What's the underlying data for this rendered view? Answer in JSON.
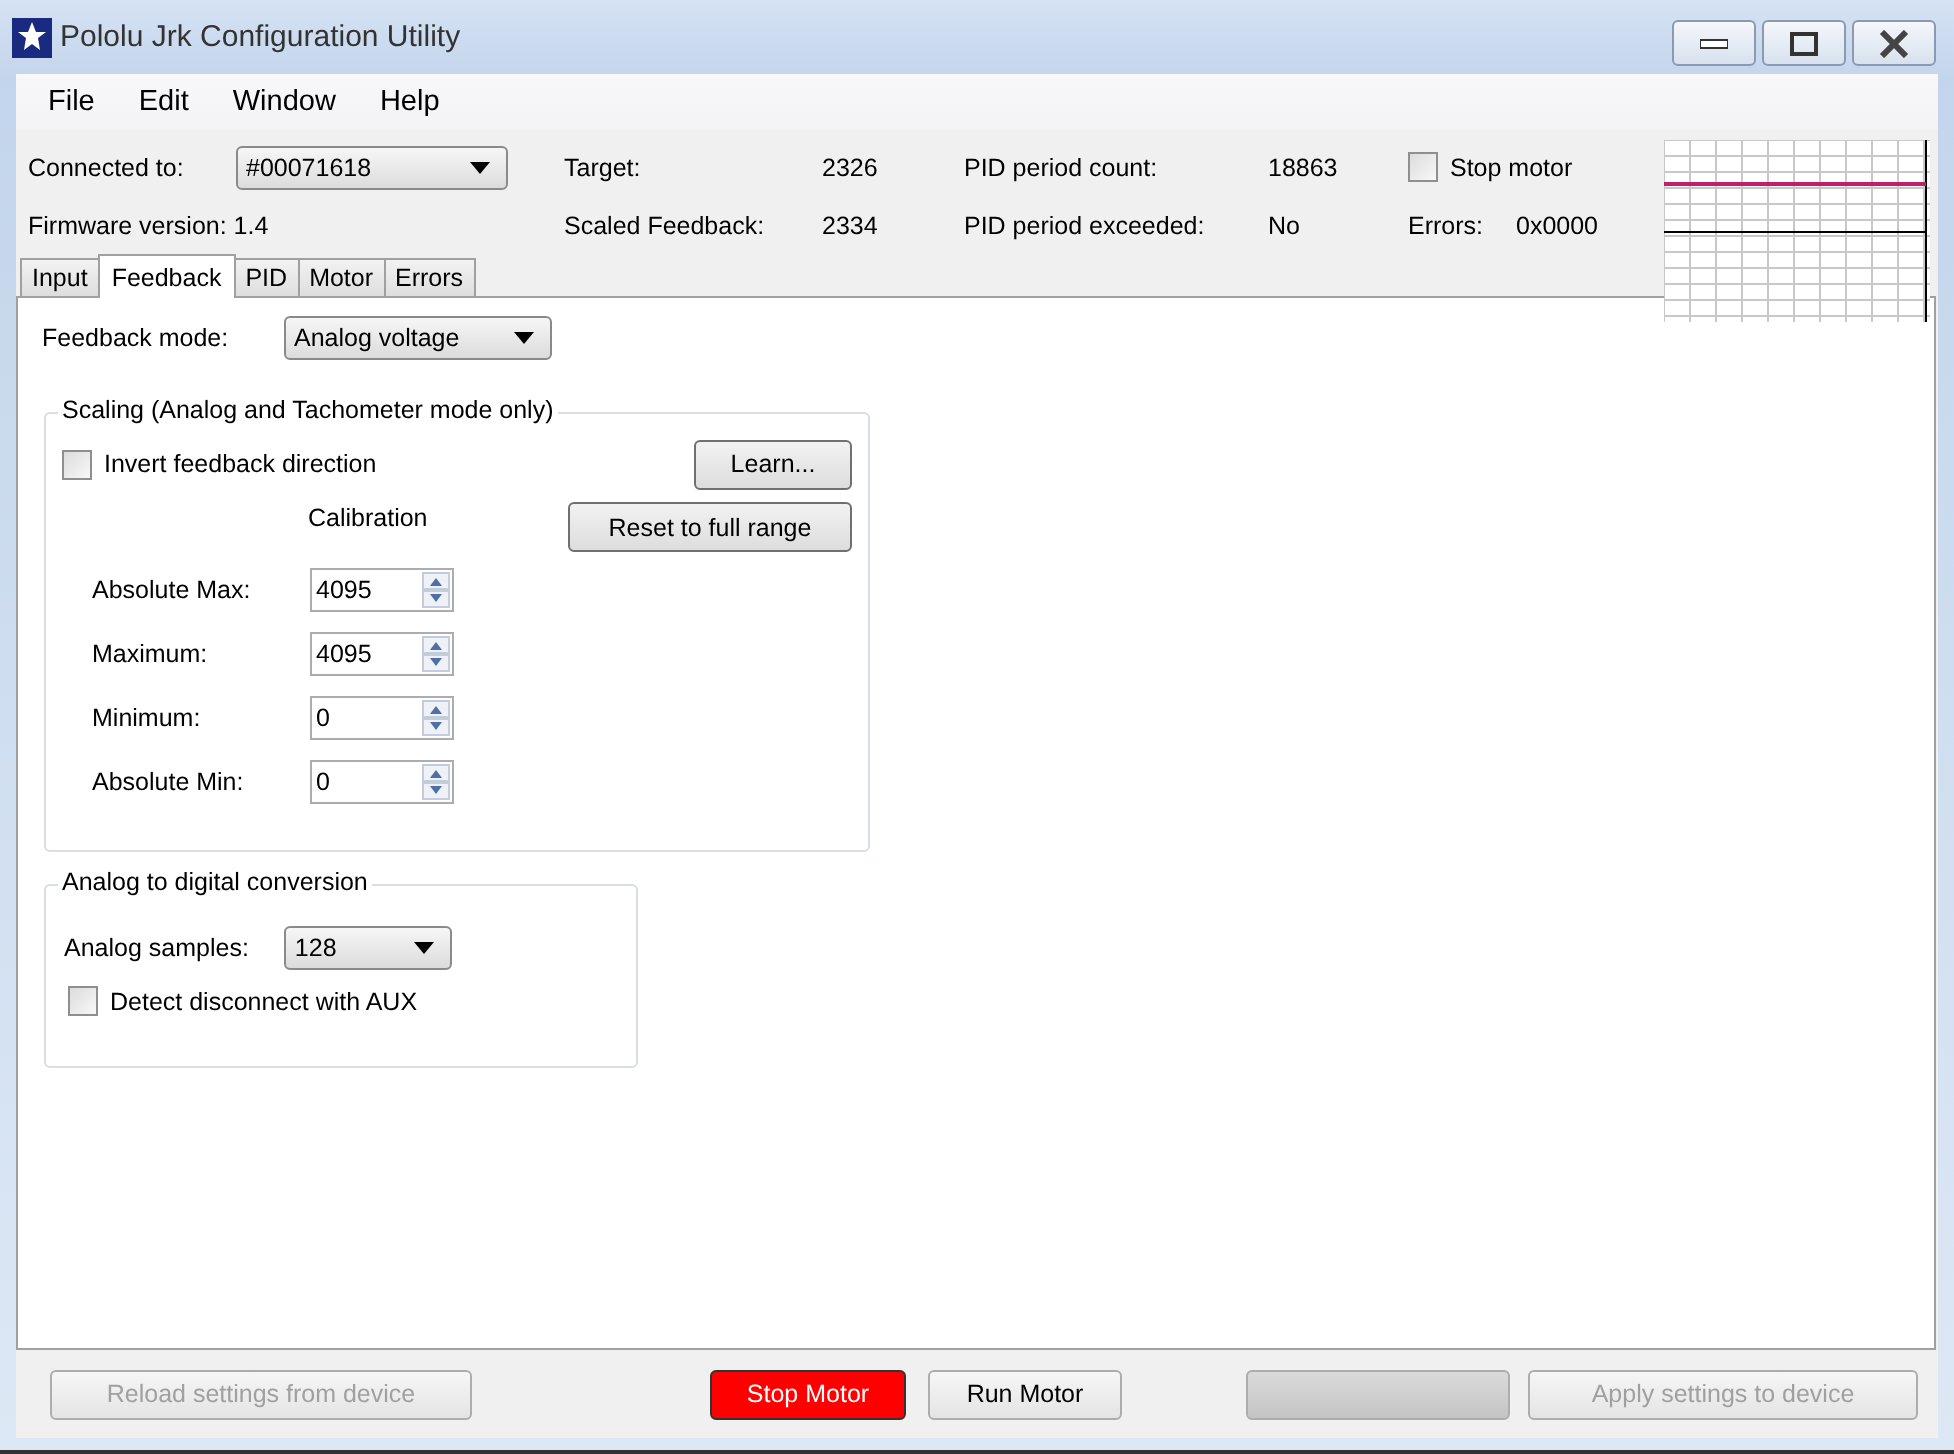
{
  "window": {
    "title": "Pololu Jrk Configuration Utility"
  },
  "menu": [
    "File",
    "Edit",
    "Window",
    "Help"
  ],
  "header": {
    "connected_label": "Connected to:",
    "device": "#00071618",
    "firmware": "Firmware version: 1.4",
    "stats": [
      {
        "label": "Target:",
        "value": "2326"
      },
      {
        "label": "PID period count:",
        "value": "18863"
      },
      {
        "label": "Scaled Feedback:",
        "value": "2334"
      },
      {
        "label": "PID period exceeded:",
        "value": "No"
      }
    ],
    "stop_motor": {
      "label": "Stop motor",
      "checked": false
    },
    "errors_label": "Errors:",
    "errors_value": "0x0000"
  },
  "tabs": [
    {
      "label": "Input",
      "selected": false
    },
    {
      "label": "Feedback",
      "selected": true
    },
    {
      "label": "PID",
      "selected": false
    },
    {
      "label": "Motor",
      "selected": false
    },
    {
      "label": "Errors",
      "selected": false
    }
  ],
  "feedback_mode": {
    "label": "Feedback mode:",
    "value": "Analog voltage"
  },
  "scaling": {
    "title": "Scaling (Analog and Tachometer mode only)",
    "invert": {
      "label": "Invert feedback direction",
      "checked": false
    },
    "learn_button": "Learn...",
    "calibration_heading": "Calibration",
    "reset_button": "Reset to full range",
    "rows": [
      {
        "label": "Absolute Max:",
        "value": "4095"
      },
      {
        "label": "Maximum:",
        "value": "4095"
      },
      {
        "label": "Minimum:",
        "value": "0"
      },
      {
        "label": "Absolute Min:",
        "value": "0"
      }
    ]
  },
  "adc": {
    "title": "Analog to digital conversion",
    "samples_label": "Analog samples:",
    "samples_value": "128",
    "detect": {
      "label": "Detect disconnect with AUX",
      "checked": false
    }
  },
  "buttons": [
    {
      "kind": "normal",
      "label": "Reload settings from device",
      "disabled": true
    },
    {
      "kind": "stop",
      "label": "Stop Motor",
      "disabled": false
    },
    {
      "kind": "normal",
      "label": "Run Motor",
      "disabled": false
    },
    {
      "kind": "blank"
    },
    {
      "kind": "normal",
      "label": "Apply settings to device",
      "disabled": true
    }
  ]
}
